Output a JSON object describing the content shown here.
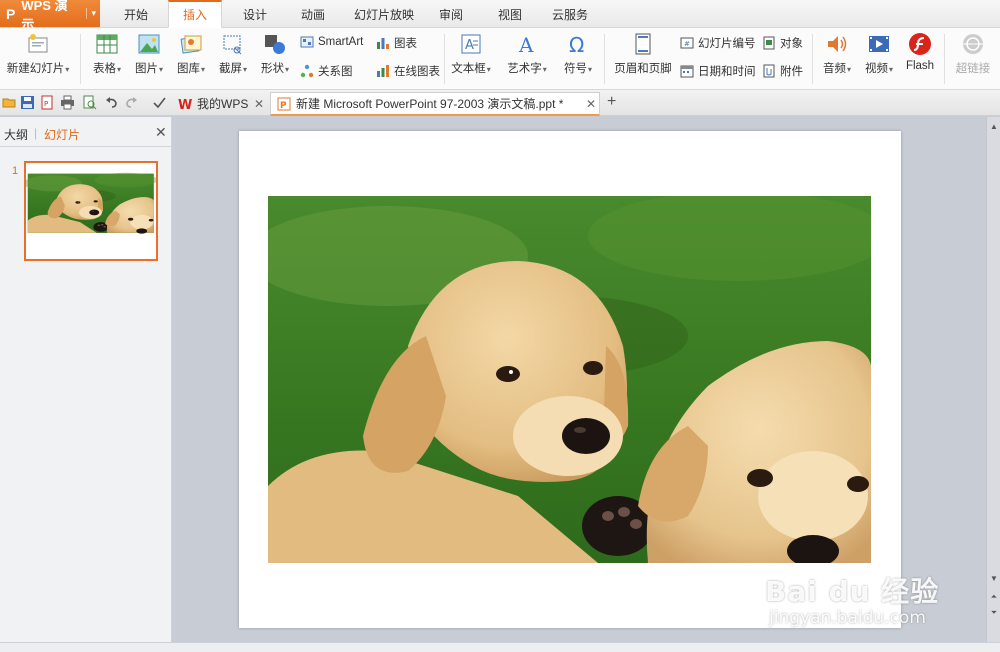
{
  "app": {
    "name": "WPS 演示",
    "logo": "P"
  },
  "menu_tabs": [
    {
      "label": "开始"
    },
    {
      "label": "插入"
    },
    {
      "label": "设计"
    },
    {
      "label": "动画"
    },
    {
      "label": "幻灯片放映"
    },
    {
      "label": "审阅"
    },
    {
      "label": "视图"
    },
    {
      "label": "云服务"
    }
  ],
  "active_menu_tab": "插入",
  "ribbon": {
    "new_slide": "新建幻灯片",
    "table": "表格",
    "picture": "图片",
    "gallery": "图库",
    "screenshot": "截屏",
    "shapes": "形状",
    "smartart": "SmartArt",
    "chart": "图表",
    "relation": "关系图",
    "online_chart": "在线图表",
    "textbox": "文本框",
    "wordart": "艺术字",
    "symbol": "符号",
    "header_footer": "页眉和页脚",
    "slide_number": "幻灯片编号",
    "object": "对象",
    "datetime": "日期和时间",
    "attachment": "附件",
    "audio": "音频",
    "video": "视频",
    "flash": "Flash",
    "hyperlink": "超链接"
  },
  "doc_tabs": [
    {
      "label": "我的WPS"
    },
    {
      "label": "新建 Microsoft PowerPoint 97-2003 演示文稿.ppt *"
    }
  ],
  "left_panel": {
    "tab_outline": "大纲",
    "tab_slides": "幻灯片",
    "slide_number": "1"
  },
  "watermark": {
    "main": "Bai du 经验",
    "url": "jingyan.baidu.com"
  },
  "colors": {
    "accent": "#e26a1a",
    "app_menu": "#e8762a",
    "grass": "#3f7a2a",
    "puppy": "#e6c48c"
  },
  "icons": [
    "new-slide-icon",
    "table-icon",
    "picture-icon",
    "gallery-icon",
    "screenshot-icon",
    "shapes-icon",
    "smartart-icon",
    "chart-icon",
    "relation-icon",
    "online-chart-icon",
    "textbox-icon",
    "wordart-icon",
    "symbol-icon",
    "header-footer-icon",
    "slide-number-icon",
    "object-icon",
    "datetime-icon",
    "attachment-icon",
    "audio-icon",
    "video-icon",
    "flash-icon",
    "hyperlink-icon"
  ]
}
